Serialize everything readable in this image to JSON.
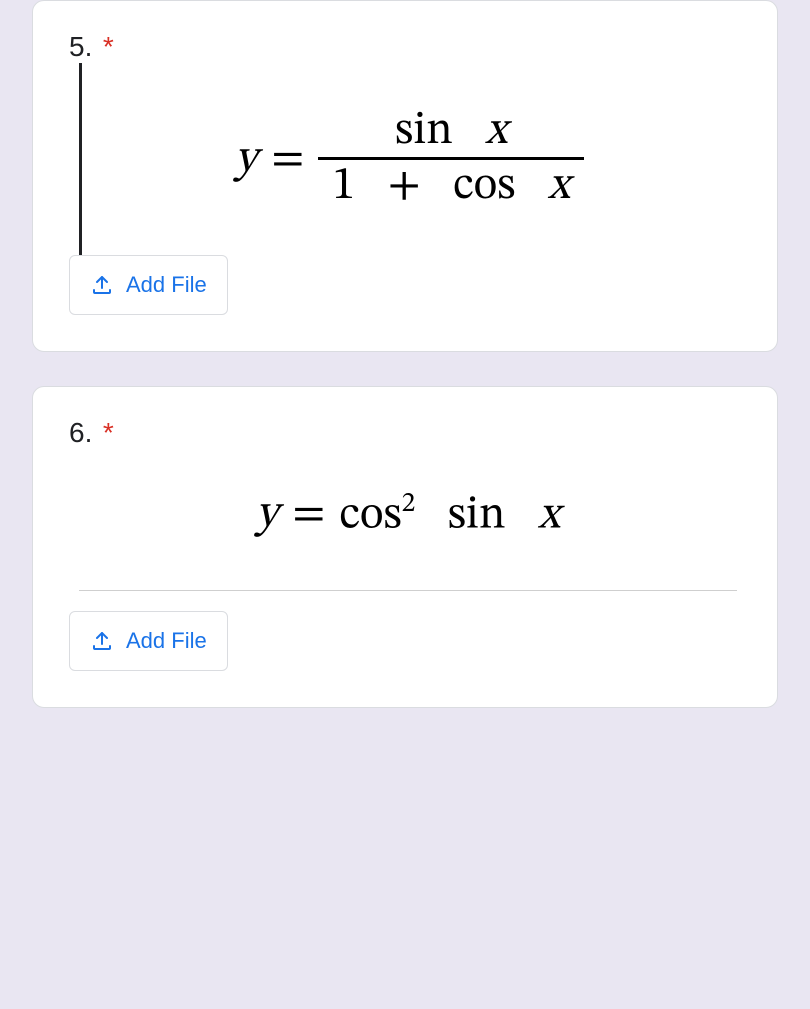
{
  "questions": [
    {
      "number": "5.",
      "required_mark": "*",
      "y_label": "y",
      "equals": "=",
      "numerator_fn": "sin",
      "numerator_var": "x",
      "denom_one": "1",
      "denom_plus": "+",
      "denom_fn": "cos",
      "denom_var": "x",
      "add_file_label": "Add File"
    },
    {
      "number": "6.",
      "required_mark": "*",
      "y_label": "y",
      "equals": "=",
      "fn1": "cos",
      "sup": "2",
      "fn2": "sin",
      "var": "x",
      "add_file_label": "Add File"
    }
  ]
}
